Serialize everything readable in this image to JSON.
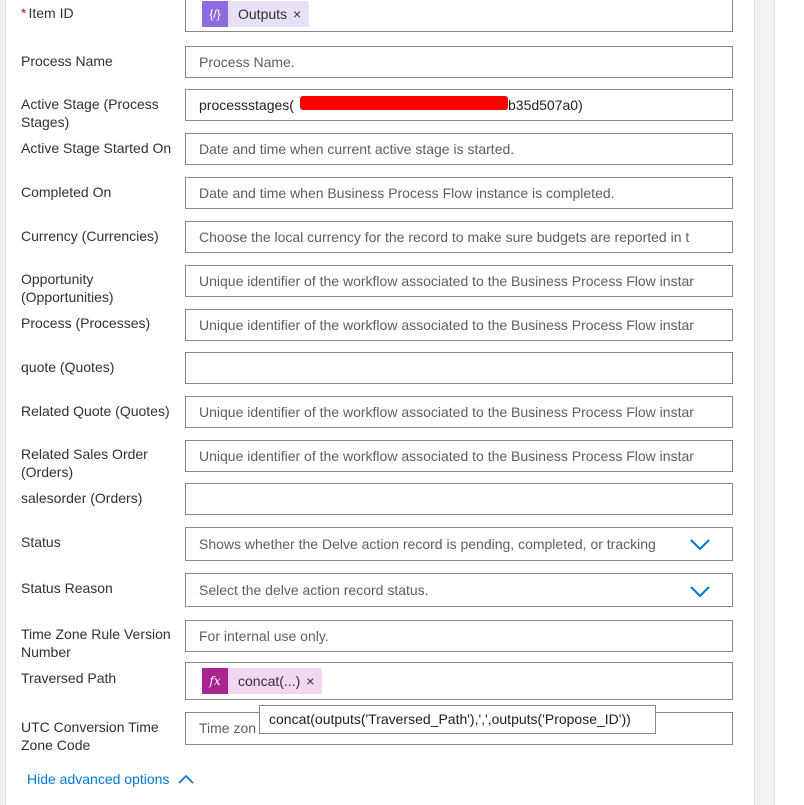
{
  "fields": [
    {
      "label": "Item ID",
      "required": true
    },
    {
      "label": "Process Name",
      "placeholder": "Process Name."
    },
    {
      "label": "Active Stage (Process Stages)",
      "value_prefix": "processstages(",
      "value_suffix": "b35d507a0)"
    },
    {
      "label": "Active Stage Started On",
      "placeholder": "Date and time when current active stage is started."
    },
    {
      "label": "Completed On",
      "placeholder": "Date and time when Business Process Flow instance is completed."
    },
    {
      "label": "Currency (Currencies)",
      "placeholder": "Choose the local currency for the record to make sure budgets are reported in t"
    },
    {
      "label": "Opportunity (Opportunities)",
      "placeholder": "Unique identifier of the workflow associated to the Business Process Flow instar"
    },
    {
      "label": "Process (Processes)",
      "placeholder": "Unique identifier of the workflow associated to the Business Process Flow instar"
    },
    {
      "label": "quote (Quotes)",
      "placeholder": ""
    },
    {
      "label": "Related Quote (Quotes)",
      "placeholder": "Unique identifier of the workflow associated to the Business Process Flow instar"
    },
    {
      "label": "Related Sales Order (Orders)",
      "placeholder": "Unique identifier of the workflow associated to the Business Process Flow instar"
    },
    {
      "label": "salesorder (Orders)",
      "placeholder": ""
    },
    {
      "label": "Status",
      "placeholder": "Shows whether the Delve action record is pending, completed, or tracking"
    },
    {
      "label": "Status Reason",
      "placeholder": "Select the delve action record status."
    },
    {
      "label": "Time Zone Rule Version Number",
      "placeholder": "For internal use only."
    },
    {
      "label": "Traversed Path"
    },
    {
      "label": "UTC Conversion Time Zone Code",
      "placeholder": "Time zon"
    }
  ],
  "tokens": {
    "outputs": {
      "icon": "{/}",
      "text": "Outputs",
      "close": "×",
      "color": "#e8e0f7",
      "icon_color": "#8c6cde"
    },
    "concat": {
      "icon": "fx",
      "text": "concat(...)",
      "close": "×",
      "color": "#f3d6ef",
      "icon_color": "#a8248f"
    }
  },
  "tooltip": "concat(outputs('Traversed_Path'),',',outputs('Propose_ID'))",
  "advanced_link": "Hide advanced options",
  "colors": {
    "accent": "#0078d4",
    "redaction": "#ff0000"
  }
}
